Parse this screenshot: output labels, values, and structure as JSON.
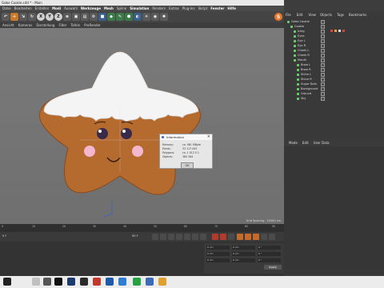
{
  "window": {
    "title": "Gebe Cookie.c4d * - Main"
  },
  "menu": [
    "Datei",
    "Bearbeiten",
    "Erstellen",
    "Modi",
    "Auswahl",
    "Werkzeuge",
    "Mesh",
    "Spline",
    "Simulation",
    "Rendern",
    "Extras",
    "Plug-ins",
    "Skript",
    "Fenster",
    "Hilfe"
  ],
  "viewport": {
    "menu": [
      "Ansicht",
      "Kameras",
      "Darstellung",
      "Filter",
      "Tafeln",
      "ProRender"
    ],
    "grid_label": "Grid Spacing : 10000 cm"
  },
  "object_manager": {
    "menu": [
      "File",
      "Edit",
      "View"
    ],
    "tabs": [
      "Objects",
      "Tags",
      "Bookmarks"
    ],
    "objects": [
      {
        "name": "Gebe Cookie",
        "depth": 0
      },
      {
        "name": "Cookie",
        "depth": 1
      },
      {
        "name": "Icing",
        "depth": 2
      },
      {
        "name": "Eyes",
        "depth": 2
      },
      {
        "name": "Eye L",
        "depth": 2
      },
      {
        "name": "Eye R",
        "depth": 2
      },
      {
        "name": "Cheek L",
        "depth": 2
      },
      {
        "name": "Cheek R",
        "depth": 2
      },
      {
        "name": "Mouth",
        "depth": 2
      },
      {
        "name": "Brow L",
        "depth": 3
      },
      {
        "name": "Brow R",
        "depth": 3
      },
      {
        "name": "Shine L",
        "depth": 3
      },
      {
        "name": "Shine R",
        "depth": 3
      },
      {
        "name": "Sugar Dots",
        "depth": 3
      },
      {
        "name": "Background",
        "depth": 3
      },
      {
        "name": "Ground",
        "depth": 3
      },
      {
        "name": "Sky",
        "depth": 3
      }
    ]
  },
  "attributes": {
    "tabs": [
      "Mode",
      "Edit",
      "User Data"
    ]
  },
  "timeline": {
    "ticks": [
      "0",
      "10",
      "20",
      "30",
      "40",
      "50",
      "60",
      "70",
      "80",
      "90"
    ],
    "current": "0 F",
    "end": "90 F"
  },
  "coordinates": {
    "fields": [
      "0 cm",
      "0 cm",
      "0 cm",
      "0 cm",
      "0 cm",
      "0 cm",
      "0 °",
      "0 °",
      "0 °"
    ],
    "apply": "Apply"
  },
  "dialog": {
    "title": "Information",
    "rows": [
      {
        "label": "Memory:",
        "value": "ca. 961 MByte"
      },
      {
        "label": "Points:",
        "value": "33 117 005"
      },
      {
        "label": "Polygons:",
        "value": "ca. 1 012 0 1"
      },
      {
        "label": "Objects:",
        "value": "360 284"
      }
    ],
    "ok": "OK"
  },
  "colors": {
    "accent": "#e8762b",
    "cookie": "#b86a2e",
    "icing": "#f2f2f2"
  }
}
